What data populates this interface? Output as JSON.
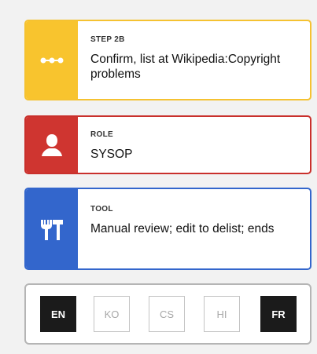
{
  "step": {
    "kicker": "STEP 2B",
    "text": "Confirm, list at Wikipedia:Copyright problems",
    "icon": "dots-icon",
    "color": "#f8c42e"
  },
  "role": {
    "kicker": "ROLE",
    "text": "SYSOP",
    "icon": "user-icon",
    "color": "#cf3530"
  },
  "tool": {
    "kicker": "TOOL",
    "text": "Manual review; edit to delist; ends",
    "icon": "tools-icon",
    "color": "#3366cc"
  },
  "languages": [
    {
      "code": "EN",
      "active": true
    },
    {
      "code": "KO",
      "active": false
    },
    {
      "code": "CS",
      "active": false
    },
    {
      "code": "HI",
      "active": false
    },
    {
      "code": "FR",
      "active": true
    }
  ]
}
